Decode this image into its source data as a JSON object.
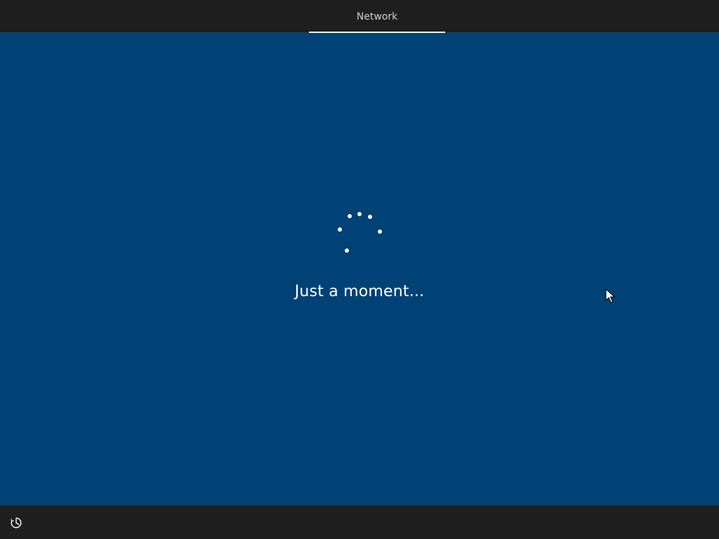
{
  "header": {
    "tabs": [
      {
        "label": "Network",
        "active": true
      }
    ]
  },
  "main": {
    "status_text": "Just a moment..."
  },
  "footer": {
    "ease_of_access_icon": "ease-of-access-icon"
  },
  "colors": {
    "background": "#004275",
    "bar": "#1f1f1f",
    "text": "#ffffff",
    "tab_text": "#cfcfcf"
  }
}
